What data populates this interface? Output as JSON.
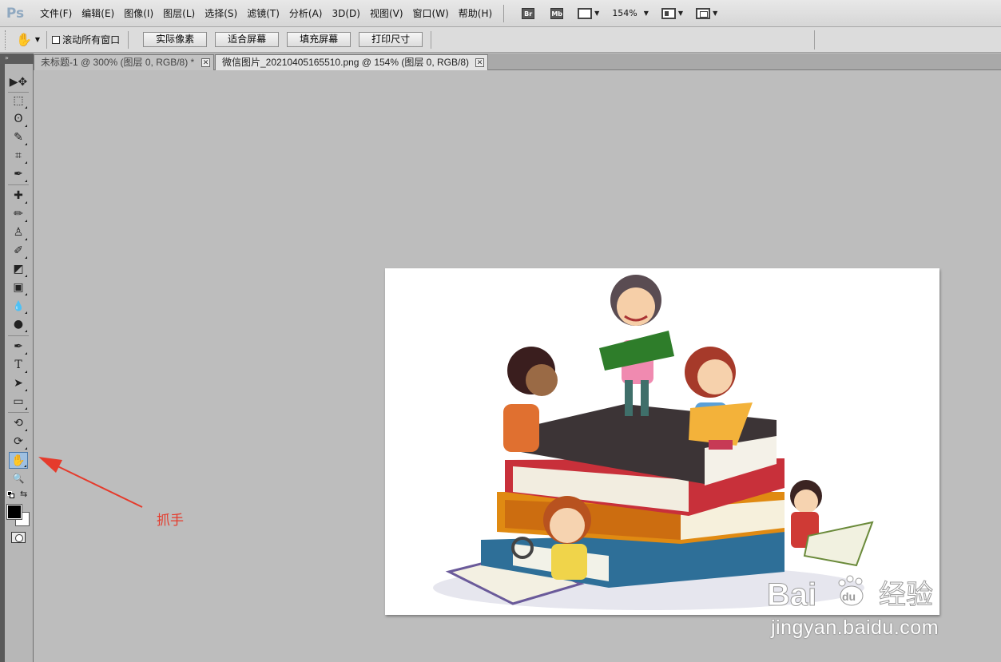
{
  "app": {
    "logo": "Ps"
  },
  "menu": {
    "items": [
      "文件(F)",
      "编辑(E)",
      "图像(I)",
      "图层(L)",
      "选择(S)",
      "滤镜(T)",
      "分析(A)",
      "3D(D)",
      "视图(V)",
      "窗口(W)",
      "帮助(H)"
    ],
    "bridge": "Br",
    "mini_bridge": "Mb",
    "zoom": "154%"
  },
  "options": {
    "scroll_all_windows": "滚动所有窗口",
    "scroll_all_checked": false,
    "buttons": [
      "实际像素",
      "适合屏幕",
      "填充屏幕",
      "打印尺寸"
    ]
  },
  "tabs": [
    {
      "label": "未标题-1 @ 300% (图层 0, RGB/8) *",
      "active": false
    },
    {
      "label": "微信图片_20210405165510.png @ 154% (图层 0, RGB/8)",
      "active": true
    }
  ],
  "toolbox": {
    "tools": [
      {
        "name": "move-tool",
        "glyph": "▶✥"
      },
      {
        "name": "marquee-tool",
        "glyph": "⬚"
      },
      {
        "name": "lasso-tool",
        "glyph": "ʘ"
      },
      {
        "name": "quick-selection-tool",
        "glyph": "✎"
      },
      {
        "name": "crop-tool",
        "glyph": "⌗"
      },
      {
        "name": "eyedropper-tool",
        "glyph": "✒"
      },
      {
        "name": "healing-brush-tool",
        "glyph": "✚"
      },
      {
        "name": "brush-tool",
        "glyph": "✏"
      },
      {
        "name": "clone-stamp-tool",
        "glyph": "♙"
      },
      {
        "name": "history-brush-tool",
        "glyph": "✐"
      },
      {
        "name": "eraser-tool",
        "glyph": "◩"
      },
      {
        "name": "gradient-tool",
        "glyph": "▣"
      },
      {
        "name": "blur-tool",
        "glyph": "💧"
      },
      {
        "name": "dodge-tool",
        "glyph": "●"
      },
      {
        "name": "pen-tool",
        "glyph": "✒"
      },
      {
        "name": "type-tool",
        "glyph": "T"
      },
      {
        "name": "path-selection-tool",
        "glyph": "➤"
      },
      {
        "name": "shape-tool",
        "glyph": "▭"
      },
      {
        "name": "3d-rotate-tool",
        "glyph": "⟲"
      },
      {
        "name": "3d-orbit-tool",
        "glyph": "⟳"
      },
      {
        "name": "hand-tool",
        "glyph": "✋"
      },
      {
        "name": "zoom-tool",
        "glyph": "🔍"
      }
    ],
    "selected": "hand-tool",
    "foreground_color": "#000000",
    "background_color": "#ffffff"
  },
  "annotation": {
    "label": "抓手",
    "color": "#e53b2c"
  },
  "watermark": {
    "brand": "Bai",
    "paw": "du",
    "text": "经验",
    "url": "jingyan.baidu.com"
  }
}
